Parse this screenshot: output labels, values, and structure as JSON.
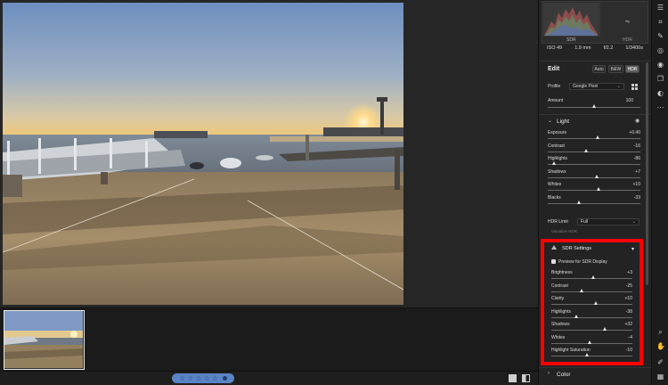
{
  "histogram": {
    "sdr_label": "SDR",
    "hdr_label": "HDR",
    "hdr_icon": "hdr-icon"
  },
  "camera_info": {
    "iso": "ISO 49",
    "focal": "1.9 mm",
    "aperture": "f/2.2",
    "shutter": "1/3400s"
  },
  "edit": {
    "title": "Edit",
    "modes": {
      "auto": "Auto",
      "bw": "B&W",
      "hdr": "HDR",
      "active": "HDR"
    },
    "profile_label": "Profile",
    "profile_value": "Google Pixel",
    "amount_label": "Amount",
    "amount_value": "100",
    "amount_level": 0.5
  },
  "light": {
    "title": "Light",
    "sliders": [
      {
        "label": "Exposure",
        "value": "+0.40",
        "level": 0.54
      },
      {
        "label": "Contrast",
        "value": "-16",
        "level": 0.42
      },
      {
        "label": "Highlights",
        "value": "-86",
        "level": 0.07
      },
      {
        "label": "Shadows",
        "value": "+7",
        "level": 0.53
      },
      {
        "label": "Whites",
        "value": "+10",
        "level": 0.55
      },
      {
        "label": "Blacks",
        "value": "-33",
        "level": 0.34
      }
    ],
    "hdr_limit_label": "HDR Limit",
    "hdr_limit_value": "Full",
    "visualize_label": "Visualize HDR"
  },
  "sdr_settings": {
    "title": "SDR Settings",
    "preview_label": "Preview for SDR Display",
    "preview_checked": true,
    "sliders": [
      {
        "label": "Brightness",
        "value": "+3",
        "level": 0.52
      },
      {
        "label": "Contrast",
        "value": "-25",
        "level": 0.38
      },
      {
        "label": "Clarity",
        "value": "+10",
        "level": 0.55
      },
      {
        "label": "Highlights",
        "value": "-38",
        "level": 0.31
      },
      {
        "label": "Shadows",
        "value": "+32",
        "level": 0.66
      },
      {
        "label": "Whites",
        "value": "-4",
        "level": 0.48
      },
      {
        "label": "Highlight Saturation",
        "value": "-10",
        "level": 0.45
      }
    ]
  },
  "color": {
    "title": "Color"
  },
  "rating": {
    "stars": [
      "☆",
      "☆",
      "☆",
      "☆",
      "☆"
    ],
    "rating_value": 0
  },
  "accent": {
    "highlight_box": "#ff0000",
    "rating_pill": "#5b84c6"
  },
  "tools": [
    "sliders-icon",
    "crop-icon",
    "healing-brush-icon",
    "red-eye-icon",
    "eye-icon",
    "layers-icon",
    "presets-icon",
    "more-icon",
    "zoom-icon",
    "hand-icon",
    "color-sampler-icon",
    "grid-icon"
  ]
}
